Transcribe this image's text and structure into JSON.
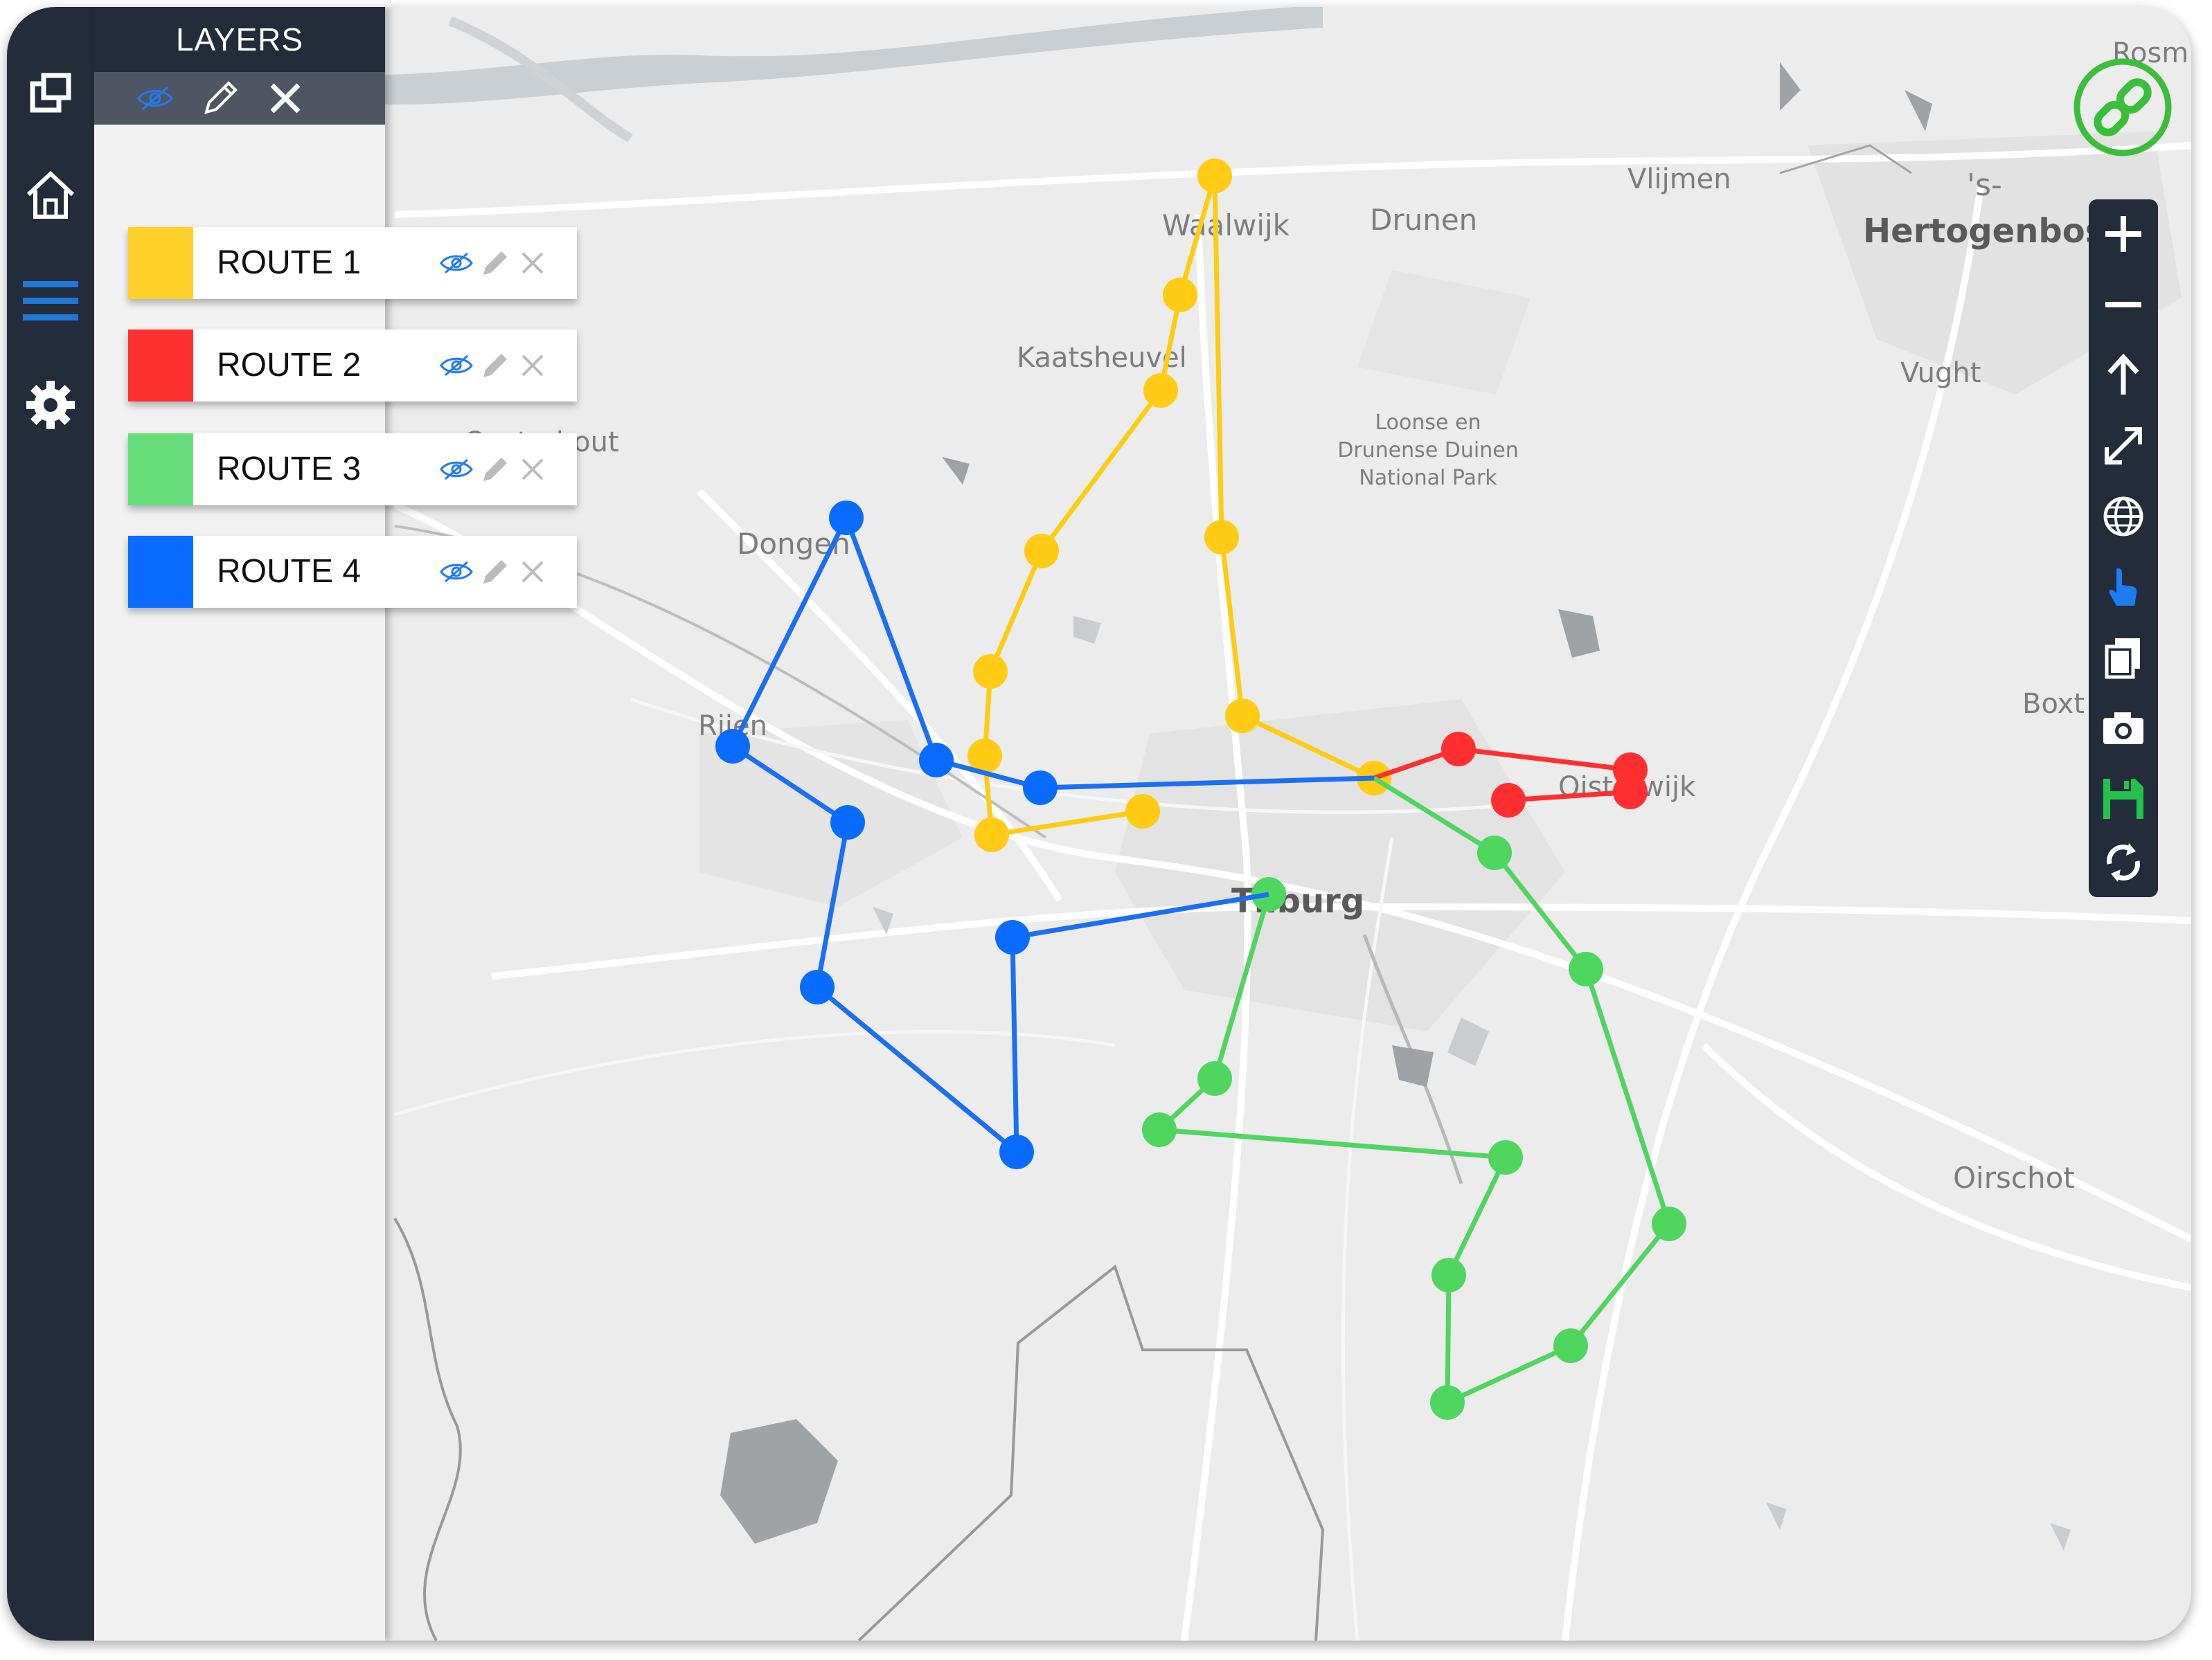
{
  "layers_panel": {
    "title": "LAYERS",
    "toolbar": {
      "toggle_icon": "eye-slash-icon",
      "edit_icon": "pencil-icon",
      "close_icon": "close-icon"
    }
  },
  "nav": {
    "icons": [
      "layers-icon",
      "home-icon",
      "menu-icon",
      "gear-icon"
    ]
  },
  "routes": [
    {
      "label": "ROUTE 1",
      "color": "#ffd02a"
    },
    {
      "label": "ROUTE 2",
      "color": "#ff3030"
    },
    {
      "label": "ROUTE 3",
      "color": "#67de7a"
    },
    {
      "label": "ROUTE 4",
      "color": "#0a6cff"
    }
  ],
  "map": {
    "places": {
      "rosmalen": "Rosm",
      "vlijmen": "Vlijmen",
      "s_prefix": "'s-",
      "hertogenbosch": "Hertogenbosc",
      "waalwijk": "Waalwijk",
      "drunen": "Drunen",
      "kaatsheuvel": "Kaatsheuvel",
      "vught": "Vught",
      "park_line1": "Loonse en",
      "park_line2": "Drunense Duinen",
      "park_line3": "National Park",
      "oosterhout": "Oosterhout",
      "dongen": "Dongen",
      "rijen": "Rijen",
      "boxtel": "Boxt",
      "oisterwijk": "Oisterwijk",
      "tilburg": "Tilburg",
      "oirschot": "Oirschot"
    }
  },
  "right_toolbar": {
    "icons": [
      "plus-icon",
      "minus-icon",
      "arrow-up-icon",
      "expand-icon",
      "globe-icon",
      "pointer-icon",
      "copy-icon",
      "camera-icon",
      "save-icon",
      "refresh-icon"
    ],
    "colors": {
      "pointer": "#1f7bf0",
      "save": "#23c24a"
    }
  },
  "link_button": {
    "icon": "link-icon",
    "color": "#3bbf3b"
  }
}
